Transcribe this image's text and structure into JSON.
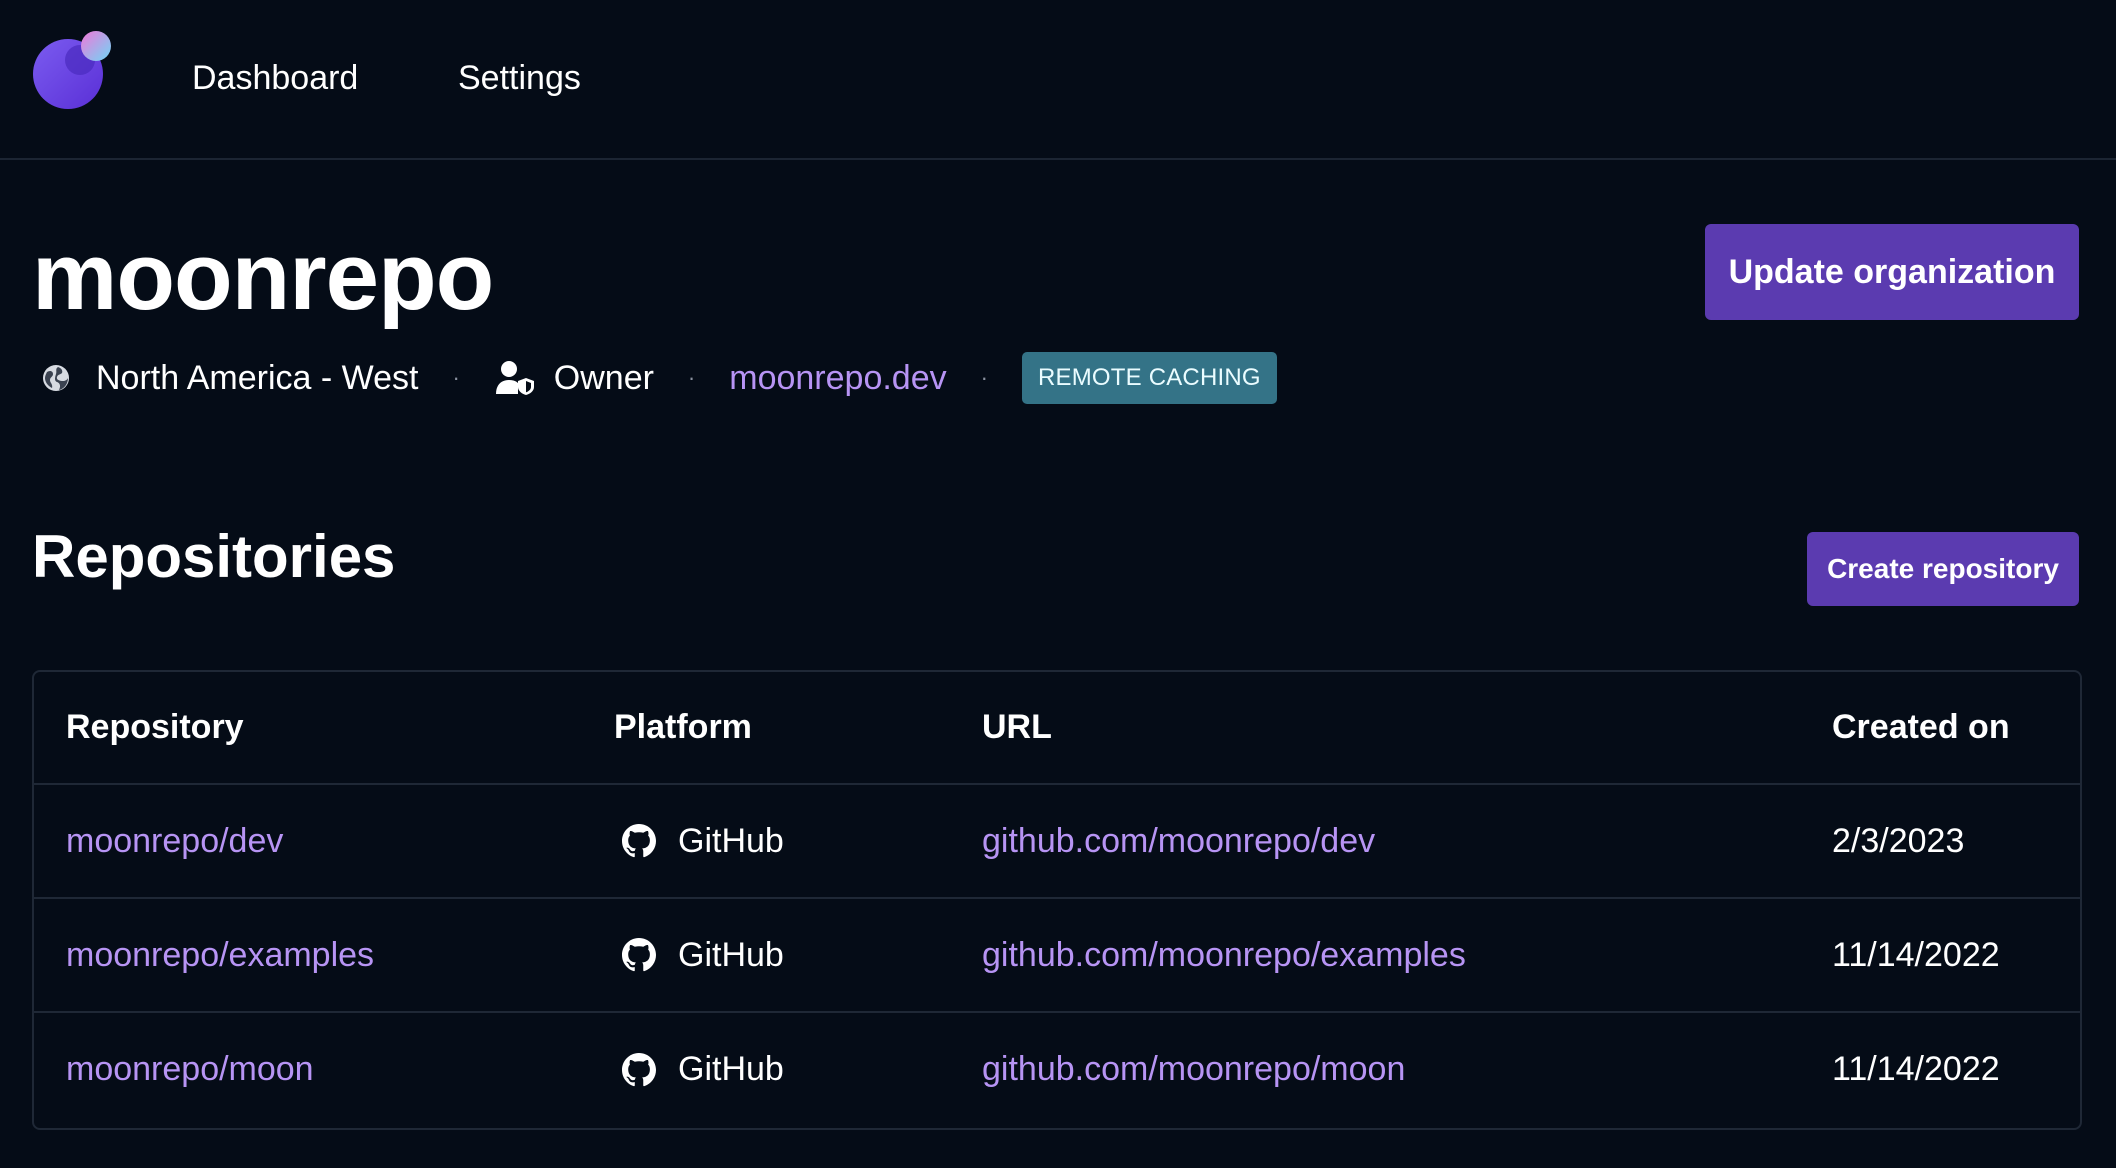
{
  "nav": {
    "logo_icon": "moon-logo-icon",
    "items": [
      "Dashboard",
      "Settings"
    ]
  },
  "org": {
    "name": "moonrepo",
    "update_button": "Update organization",
    "region_icon": "globe-icon",
    "region": "North America - West",
    "role_icon": "user-shield-icon",
    "role": "Owner",
    "website": "moonrepo.dev",
    "badge": "REMOTE CACHING"
  },
  "repositories": {
    "title": "Repositories",
    "create_button": "Create repository",
    "columns": [
      "Repository",
      "Platform",
      "URL",
      "Created on"
    ],
    "rows": [
      {
        "repo": "moonrepo/dev",
        "platform": "GitHub",
        "platform_icon": "github-icon",
        "url": "github.com/moonrepo/dev",
        "created": "2/3/2023"
      },
      {
        "repo": "moonrepo/examples",
        "platform": "GitHub",
        "platform_icon": "github-icon",
        "url": "github.com/moonrepo/examples",
        "created": "11/14/2022"
      },
      {
        "repo": "moonrepo/moon",
        "platform": "GitHub",
        "platform_icon": "github-icon",
        "url": "github.com/moonrepo/moon",
        "created": "11/14/2022"
      }
    ]
  },
  "colors": {
    "background": "#050c17",
    "accent": "#5b3bb0",
    "link": "#b794f4",
    "badge": "#347387"
  }
}
